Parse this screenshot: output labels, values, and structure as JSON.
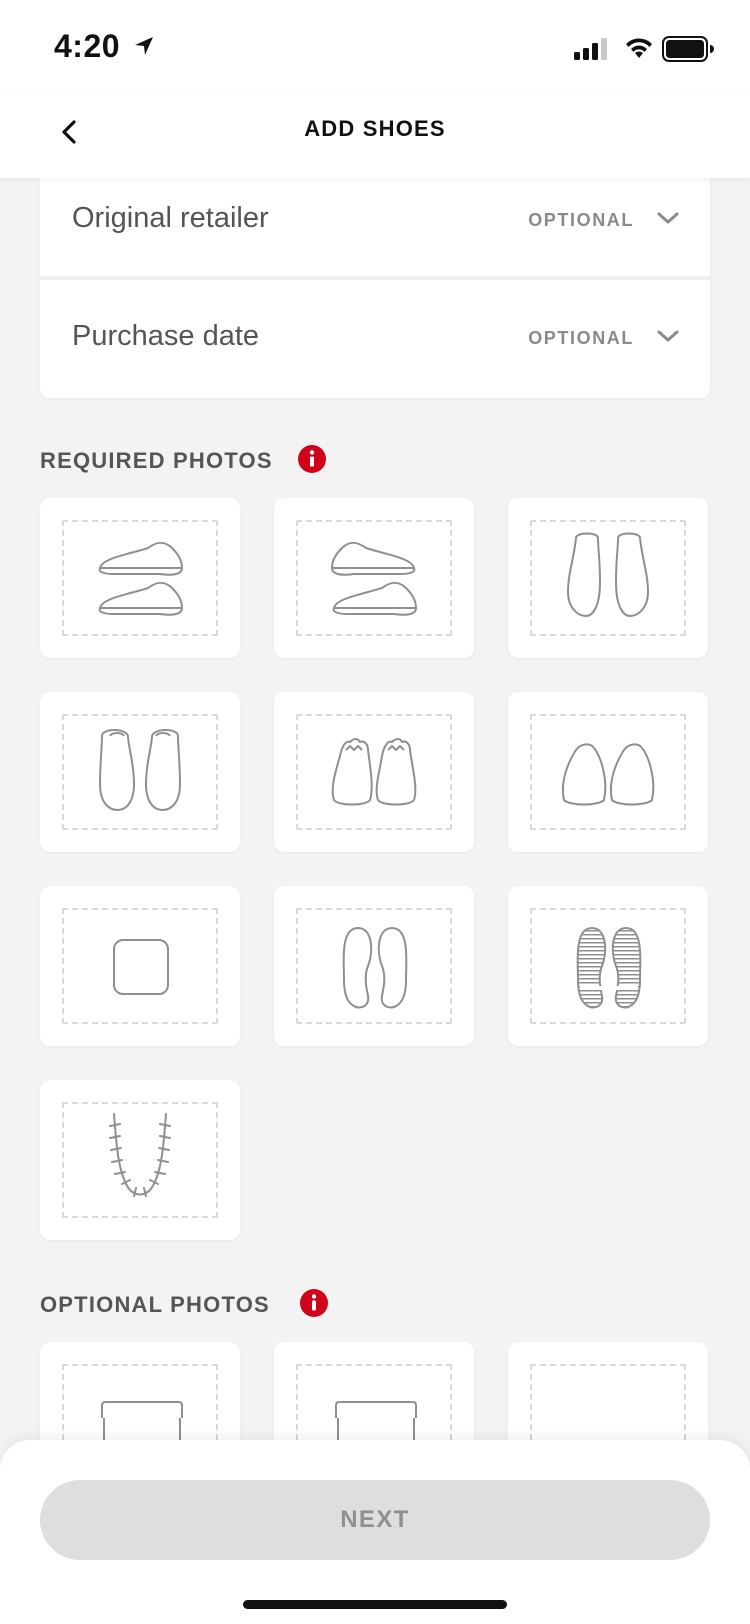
{
  "status_bar": {
    "time": "4:20",
    "icons": [
      "location-arrow-icon",
      "cellular-signal-icon",
      "wifi-icon",
      "battery-icon"
    ]
  },
  "nav": {
    "title": "ADD SHOES",
    "back_icon": "chevron-left-icon"
  },
  "form": {
    "rows": [
      {
        "label": "Original retailer",
        "tag": "OPTIONAL",
        "icon": "chevron-down-icon"
      },
      {
        "label": "Purchase date",
        "tag": "OPTIONAL",
        "icon": "chevron-down-icon"
      }
    ]
  },
  "required_photos": {
    "heading": "REQUIRED PHOTOS",
    "info_icon": "info-icon",
    "accent_color": "#d0021b",
    "slots": [
      {
        "icon": "shoe-side-pair-icon"
      },
      {
        "icon": "shoe-side-pair-alt-icon"
      },
      {
        "icon": "shoe-top-pair-icon"
      },
      {
        "icon": "shoe-top-pair-alt-icon"
      },
      {
        "icon": "shoe-toe-front-icon"
      },
      {
        "icon": "shoe-heel-back-icon"
      },
      {
        "icon": "shoe-tag-icon"
      },
      {
        "icon": "insole-pair-icon"
      },
      {
        "icon": "outsole-pair-icon"
      },
      {
        "icon": "shoe-stitching-icon"
      }
    ]
  },
  "optional_photos": {
    "heading": "OPTIONAL PHOTOS",
    "info_icon": "info-icon",
    "slots": [
      {
        "icon": "box-icon"
      },
      {
        "icon": "box-alt-icon"
      },
      {
        "icon": "empty-slot"
      }
    ]
  },
  "footer": {
    "next_label": "NEXT"
  }
}
